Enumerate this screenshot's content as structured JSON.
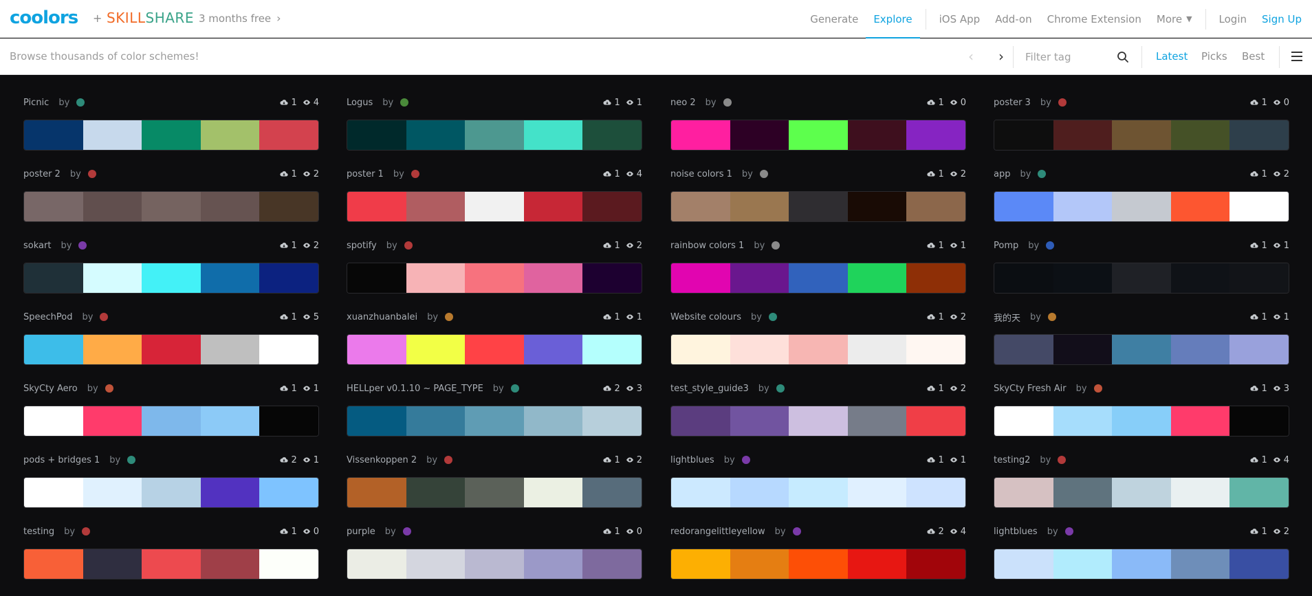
{
  "header": {
    "logo": "coolors",
    "plus": "+",
    "partner_a": "SKILL",
    "partner_b": "SHARE",
    "promo": "3 months free",
    "nav": {
      "generate": "Generate",
      "explore": "Explore",
      "ios": "iOS App",
      "addon": "Add-on",
      "chrome": "Chrome Extension",
      "more": "More",
      "login": "Login",
      "signup": "Sign Up"
    }
  },
  "subbar": {
    "browse": "Browse thousands of color schemes!",
    "filter_placeholder": "Filter tag",
    "sort": {
      "latest": "Latest",
      "picks": "Picks",
      "best": "Best"
    }
  },
  "by_label": "by",
  "palettes": [
    {
      "name": "Picnic",
      "avatar": "#2e8b7a",
      "saves": "1",
      "views": "4",
      "colors": [
        "#06356b",
        "#c7d9ec",
        "#078a66",
        "#a3c16a",
        "#d3424e"
      ]
    },
    {
      "name": "Logus",
      "avatar": "#4a8a3a",
      "saves": "1",
      "views": "1",
      "colors": [
        "#00292b",
        "#005763",
        "#4d9890",
        "#44e2c9",
        "#1d4f3b"
      ]
    },
    {
      "name": "neo 2",
      "avatar": "#8a8a8a",
      "saves": "1",
      "views": "0",
      "colors": [
        "#ff1fa0",
        "#2d0025",
        "#5dff4d",
        "#3e0f1e",
        "#8624c2"
      ]
    },
    {
      "name": "poster 3",
      "avatar": "#b23a3a",
      "saves": "1",
      "views": "0",
      "colors": [
        "#0e0e0e",
        "#4f1e1e",
        "#6e5432",
        "#455127",
        "#2e3f4b"
      ]
    },
    {
      "name": "poster 2",
      "avatar": "#b23a3a",
      "saves": "1",
      "views": "2",
      "colors": [
        "#786767",
        "#614f4e",
        "#756360",
        "#665351",
        "#483626"
      ]
    },
    {
      "name": "poster 1",
      "avatar": "#b23a3a",
      "saves": "1",
      "views": "4",
      "colors": [
        "#f03c49",
        "#b05d61",
        "#f1f1f1",
        "#c72736",
        "#5b1a1f"
      ]
    },
    {
      "name": "noise colors 1",
      "avatar": "#8a8a8a",
      "saves": "1",
      "views": "2",
      "colors": [
        "#a38069",
        "#9a7750",
        "#2f2d31",
        "#190b05",
        "#8c674b"
      ]
    },
    {
      "name": "app",
      "avatar": "#2e8b7a",
      "saves": "1",
      "views": "2",
      "colors": [
        "#5b89f7",
        "#b3c7f9",
        "#c5c9d0",
        "#fd5630",
        "#ffffff"
      ]
    },
    {
      "name": "sokart",
      "avatar": "#7a3aa8",
      "saves": "1",
      "views": "2",
      "colors": [
        "#1f3038",
        "#d5fcff",
        "#43f1f7",
        "#106daa",
        "#0c2280"
      ]
    },
    {
      "name": "spotify",
      "avatar": "#b23a3a",
      "saves": "1",
      "views": "2",
      "colors": [
        "#070707",
        "#f7b3b6",
        "#f7727e",
        "#e0639f",
        "#1d0030"
      ]
    },
    {
      "name": "rainbow colors 1",
      "avatar": "#8a8a8a",
      "saves": "1",
      "views": "1",
      "colors": [
        "#e105b0",
        "#6a178e",
        "#3162bc",
        "#1fd35b",
        "#8e2f06"
      ]
    },
    {
      "name": "Pomp",
      "avatar": "#2e5cb8",
      "saves": "1",
      "views": "1",
      "colors": [
        "#0b0e12",
        "#0c1015",
        "#1f2126",
        "#0f1217",
        "#121418"
      ]
    },
    {
      "name": "SpeechPod",
      "avatar": "#b23a3a",
      "saves": "1",
      "views": "5",
      "colors": [
        "#3dbde9",
        "#ffab47",
        "#d72438",
        "#bfbfbf",
        "#ffffff"
      ]
    },
    {
      "name": "xuanzhuanbalei",
      "avatar": "#b87a2e",
      "saves": "1",
      "views": "1",
      "colors": [
        "#eb7aeb",
        "#f2ff46",
        "#ff4246",
        "#6a5fd7",
        "#b4fffd"
      ]
    },
    {
      "name": "Website colours",
      "avatar": "#2e8b7a",
      "saves": "1",
      "views": "2",
      "colors": [
        "#fff4de",
        "#fee0da",
        "#f7b6b3",
        "#ececec",
        "#fff7f2"
      ]
    },
    {
      "name": "我的天",
      "avatar": "#b87a2e",
      "saves": "1",
      "views": "1",
      "colors": [
        "#444966",
        "#120e1a",
        "#3f7fa3",
        "#657dbb",
        "#99a1dc"
      ]
    },
    {
      "name": "SkyCty Aero",
      "avatar": "#c0533a",
      "saves": "1",
      "views": "1",
      "colors": [
        "#ffffff",
        "#ff3b6b",
        "#7eb8eb",
        "#8ccaf7",
        "#060606"
      ]
    },
    {
      "name": "HELLper v0.1.10 ~ PAGE_TYPE",
      "avatar": "#2e8b7a",
      "saves": "2",
      "views": "3",
      "colors": [
        "#055b81",
        "#357b9b",
        "#5f9cb4",
        "#91b8c9",
        "#b7cfdb"
      ]
    },
    {
      "name": "test_style_guide3",
      "avatar": "#2e8b7a",
      "saves": "1",
      "views": "2",
      "colors": [
        "#5b3d7f",
        "#7154a0",
        "#cdbfe0",
        "#767c89",
        "#f03e47"
      ]
    },
    {
      "name": "SkyCty Fresh Air",
      "avatar": "#c0533a",
      "saves": "1",
      "views": "3",
      "colors": [
        "#ffffff",
        "#a6ddfc",
        "#87cef9",
        "#ff3b6b",
        "#060606"
      ]
    },
    {
      "name": "pods + bridges 1",
      "avatar": "#2e8b7a",
      "saves": "2",
      "views": "1",
      "colors": [
        "#ffffff",
        "#e0f1fe",
        "#b7d2e5",
        "#5232c0",
        "#7ec3ff"
      ]
    },
    {
      "name": "Vissenkoppen 2",
      "avatar": "#b23a3a",
      "saves": "1",
      "views": "2",
      "colors": [
        "#b36127",
        "#354339",
        "#5b6159",
        "#ebf0e3",
        "#576c7b"
      ]
    },
    {
      "name": "lightblues",
      "avatar": "#7a3aa8",
      "saves": "1",
      "views": "1",
      "colors": [
        "#cce9ff",
        "#b7d9ff",
        "#c6ebff",
        "#e0f0ff",
        "#cee3ff"
      ]
    },
    {
      "name": "testing2",
      "avatar": "#b23a3a",
      "saves": "1",
      "views": "4",
      "colors": [
        "#d6c1c2",
        "#5f737e",
        "#bfd3de",
        "#e9f0f1",
        "#61b5a7"
      ]
    },
    {
      "name": "testing",
      "avatar": "#b23a3a",
      "saves": "1",
      "views": "0",
      "colors": [
        "#f86037",
        "#2f2e40",
        "#ed4a4f",
        "#9f3f48",
        "#fdfffa"
      ]
    },
    {
      "name": "purple",
      "avatar": "#7a3aa8",
      "saves": "1",
      "views": "0",
      "colors": [
        "#ebede5",
        "#d4d6df",
        "#bab9d1",
        "#9b99c8",
        "#7e6a9e"
      ]
    },
    {
      "name": "redorangelittleyellow",
      "avatar": "#7a3aa8",
      "saves": "2",
      "views": "4",
      "colors": [
        "#fdaf02",
        "#e57e12",
        "#fd4f06",
        "#e71712",
        "#a1050a"
      ]
    },
    {
      "name": "lightblues",
      "avatar": "#7a3aa8",
      "saves": "1",
      "views": "2",
      "colors": [
        "#cbe1fb",
        "#b1ecfd",
        "#8abaf8",
        "#6e8eb9",
        "#394fa3"
      ]
    }
  ]
}
